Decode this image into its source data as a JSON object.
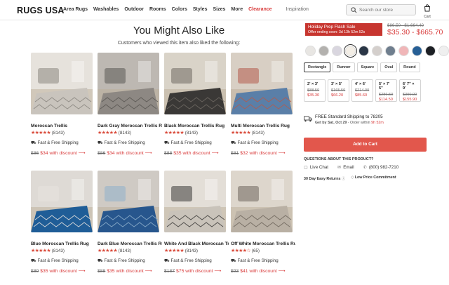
{
  "header": {
    "logo_a": "RUGS",
    "logo_b": "USA",
    "nav": [
      "Area Rugs",
      "Washables",
      "Outdoor",
      "Rooms",
      "Colors",
      "Styles",
      "Sizes",
      "More",
      "Clearance"
    ],
    "inspiration": "Inspiration",
    "search_placeholder": "Search our store",
    "cart_label": "Cart"
  },
  "recommendations": {
    "title": "You Might Also Like",
    "subtitle": "Customers who viewed this item also liked the following:",
    "shipping_label": "Fast & Free Shipping",
    "products": [
      {
        "name": "Moroccan Trellis",
        "reviews": "(8143)",
        "stars": "★★★★★",
        "old_price": "$86",
        "new_price": "$34 with discount ⟶",
        "palette": [
          "#e6e2dc",
          "#c9c4bd",
          "#8a8680"
        ]
      },
      {
        "name": "Dark Gray Moroccan Trellis Rug",
        "reviews": "(8143)",
        "stars": "★★★★★",
        "old_price": "$86",
        "new_price": "$34 with discount ⟶",
        "palette": [
          "#bdb8b2",
          "#8d8883",
          "#5a5753"
        ]
      },
      {
        "name": "Black Moroccan Trellis Rug",
        "reviews": "(8143)",
        "stars": "★★★★★",
        "old_price": "$88",
        "new_price": "$35 with discount ⟶",
        "palette": [
          "#d9d3c8",
          "#3a3836",
          "#6f6a63"
        ]
      },
      {
        "name": "Multi Moroccan Trellis Rug",
        "reviews": "(8143)",
        "stars": "★★★★★",
        "old_price": "$81",
        "new_price": "$32 with discount ⟶",
        "palette": [
          "#d8cfc4",
          "#5a7fa8",
          "#b55b4c"
        ]
      },
      {
        "name": "Blue Moroccan Trellis Rug",
        "reviews": "(8143)",
        "stars": "★★★★★",
        "old_price": "$89",
        "new_price": "$35 with discount ⟶",
        "palette": [
          "#dedad5",
          "#1f5d97",
          "#e8e4df"
        ]
      },
      {
        "name": "Dark Blue Moroccan Trellis Rug",
        "reviews": "(8143)",
        "stars": "★★★★★",
        "old_price": "$88",
        "new_price": "$35 with discount ⟶",
        "palette": [
          "#cfcac4",
          "#27568d",
          "#8fb0cc"
        ]
      },
      {
        "name": "White And Black Moroccan Trellis Rug",
        "reviews": "(8143)",
        "stars": "★★★★★",
        "old_price": "$187",
        "new_price": "$75 with discount ⟶",
        "palette": [
          "#e3ded7",
          "#c9c3ba",
          "#3d3b39"
        ]
      },
      {
        "name": "Off White Moroccan Trellis Rug",
        "reviews": "(65)",
        "stars": "★★★★☆",
        "old_price": "$93",
        "new_price": "$41 with discount ⟶",
        "palette": [
          "#ddd6cc",
          "#b9b0a4",
          "#6e665c"
        ]
      }
    ]
  },
  "product_panel": {
    "promo_title": "Holiday Prep Flash Sale",
    "promo_sub": "Offer ending soon: 3d 13h 52m 52s",
    "price_strike": "$86.50 - $1,664.40",
    "price_range": "$35.30 - $665.70",
    "swatches": [
      "#e8e6e3",
      "#b3b1ae",
      "#d9d6df",
      "#f3eee6",
      "#2a3646",
      "#d4cfcc",
      "#6f7e8e",
      "#f0b6b8",
      "#275f95",
      "#1c1f24",
      "#efefef"
    ],
    "shapes": [
      "Rectangle",
      "Runner",
      "Square",
      "Oval",
      "Round"
    ],
    "sizes": [
      {
        "size": "2' × 3'",
        "old": "$88.50",
        "new": "$35.30"
      },
      {
        "size": "3' × 5'",
        "old": "$165.50",
        "new": "$66.20"
      },
      {
        "size": "4' × 6'",
        "old": "$214.00",
        "new": "$85.60"
      },
      {
        "size": "5' × 7' 5\"",
        "old": "$286.50",
        "new": "$114.50"
      },
      {
        "size": "6' 7\" × 9'",
        "old": "$390.00",
        "new": "$155.90"
      }
    ],
    "ship_line1": "FREE Standard Shipping to 78205",
    "ship_line2_a": "Get by Sat, Oct 29",
    "ship_line2_b": " - Order within ",
    "ship_line2_c": "9h 52m",
    "add_to_cart": "Add to Cart",
    "questions": "QUESTIONS ABOUT THIS PRODUCT?",
    "live_chat": "Live Chat",
    "email": "Email",
    "phone": "(800) 982-7210",
    "perk1": "30 Day Easy Returns",
    "perk2": "Low Price Commitment"
  }
}
